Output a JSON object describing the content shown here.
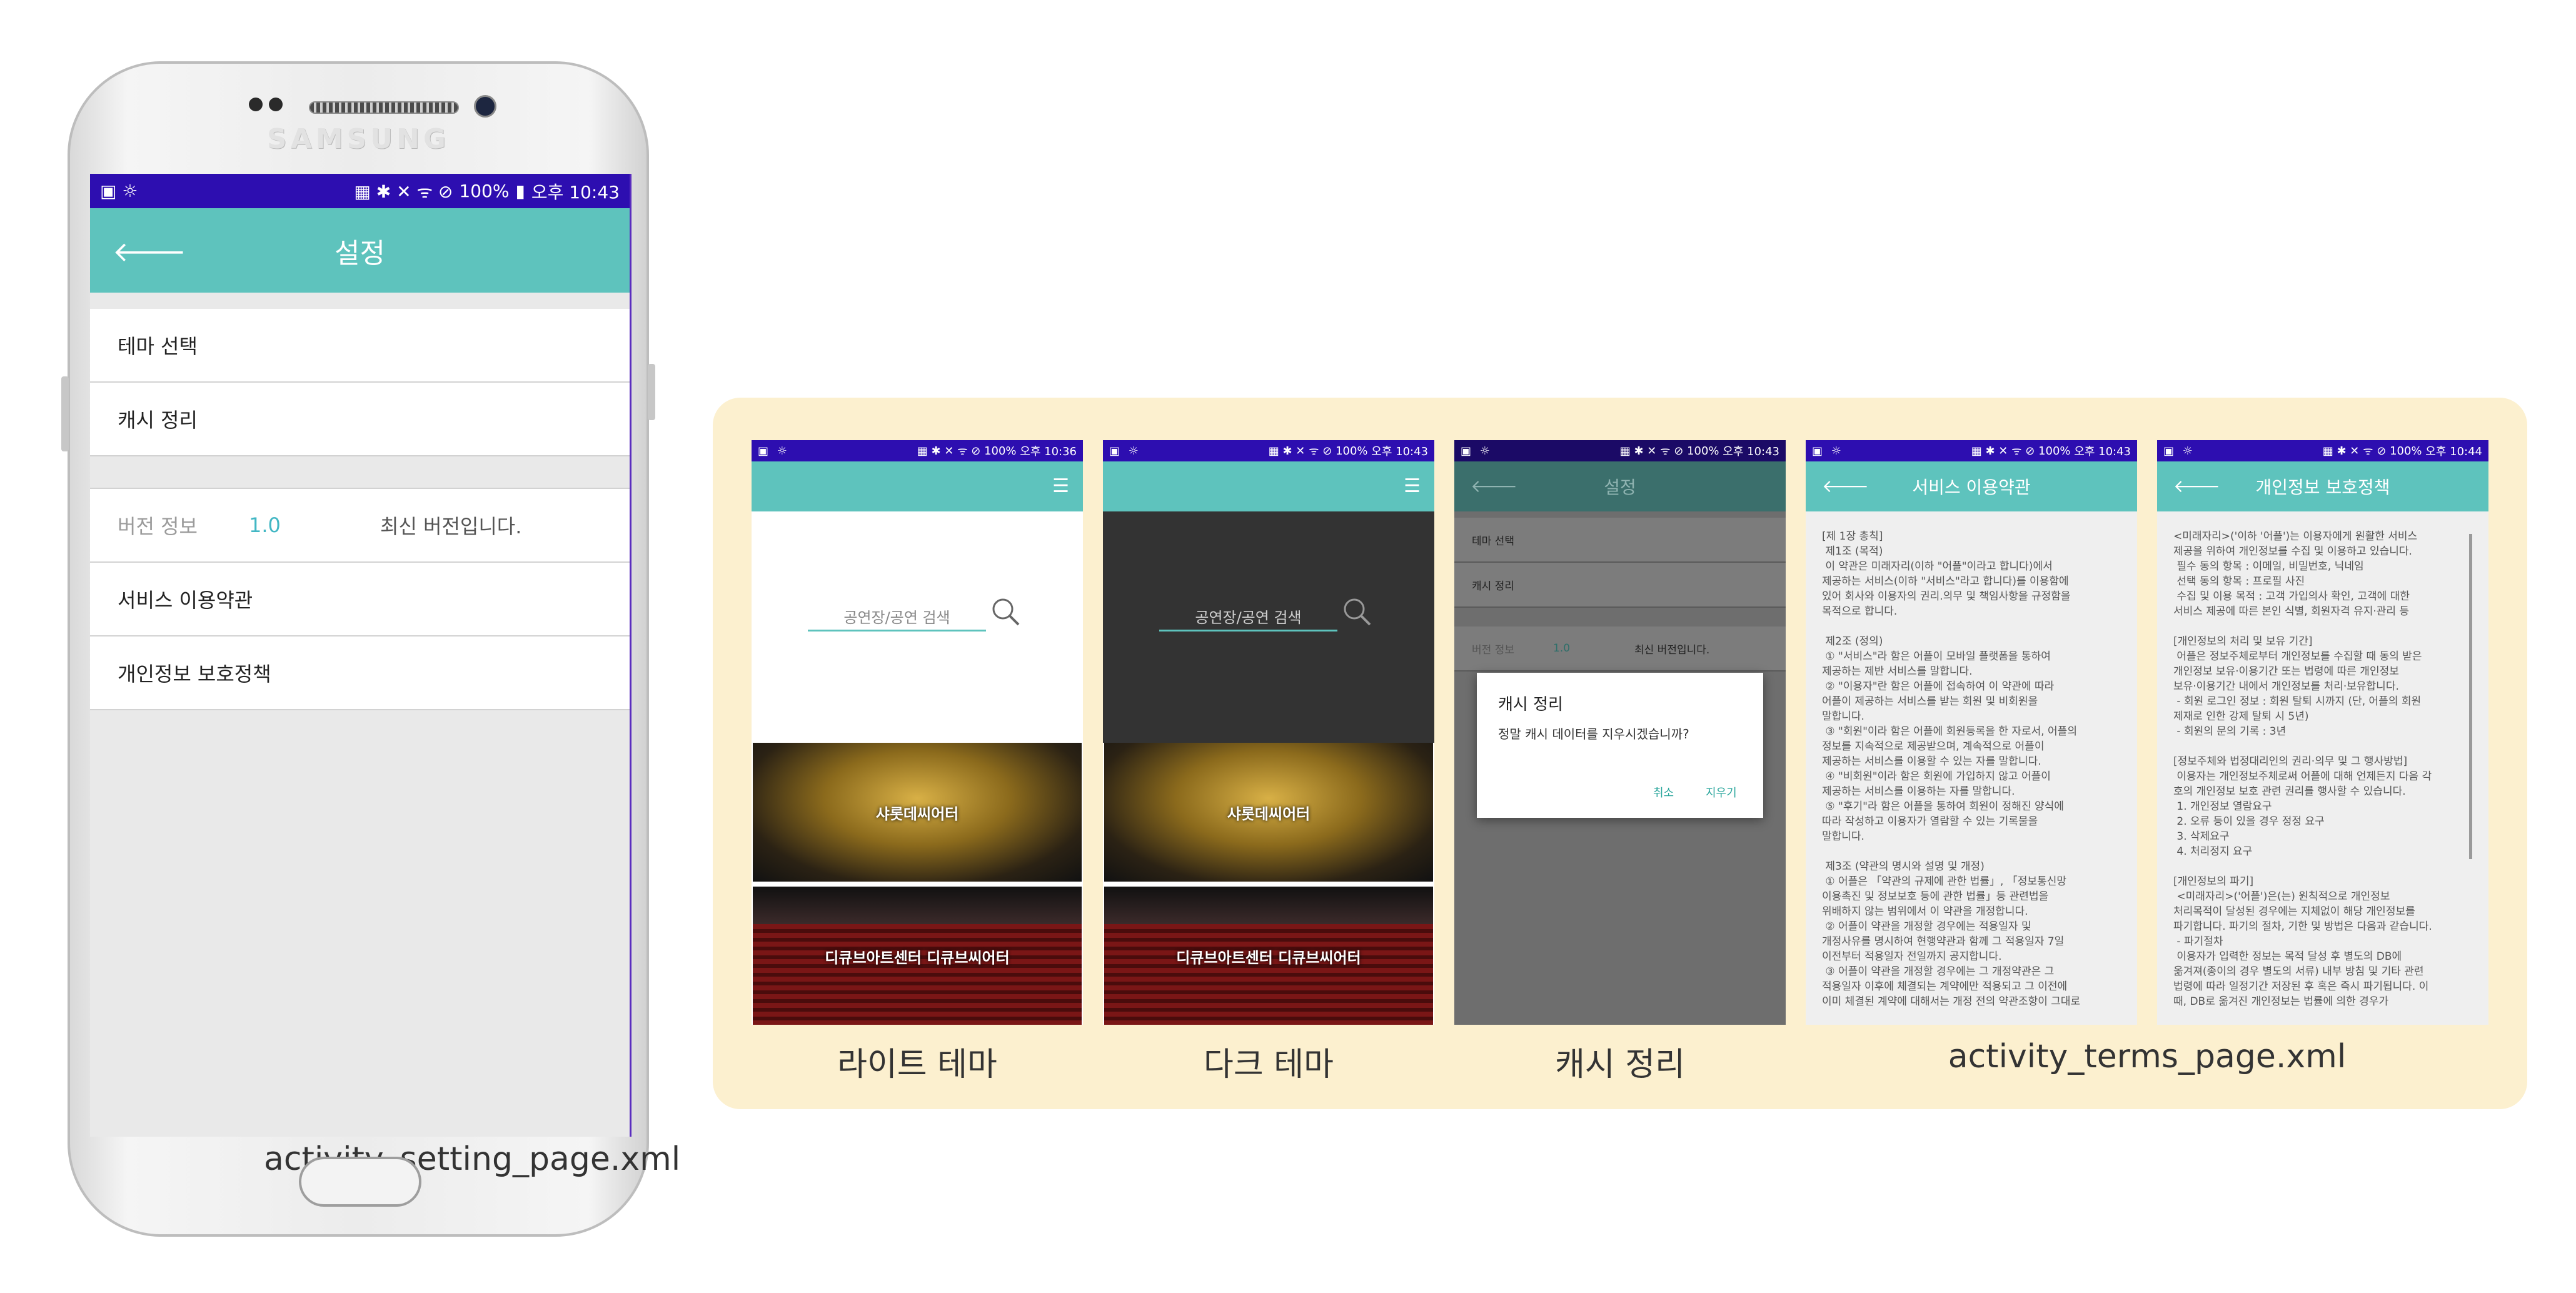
{
  "phone": {
    "brand": "SAMSUNG",
    "status": {
      "left_icons": "▣ ☼",
      "right_icons": "▦ ✱ ✕ ᯤ ⊘",
      "battery": "100%",
      "time": "오후 10:43"
    },
    "appbar": {
      "title": "설정"
    },
    "rows": {
      "theme": "테마 선택",
      "cache": "캐시 정리",
      "version_label": "버전 정보",
      "version_number": "1.0",
      "version_message": "최신 버전입니다.",
      "terms": "서비스 이용약관",
      "privacy": "개인정보 보호정책"
    },
    "caption": "activity_setting_page.xml"
  },
  "screens": {
    "light": {
      "status": {
        "left_icons": "▣ ☼",
        "right_icons": "▦ ✱ ✕ ᯤ ⊘",
        "battery": "100%",
        "time": "오후 10:36"
      },
      "search_placeholder": "공연장/공연 검색",
      "venue1": "샤롯데씨어터",
      "venue2": "디큐브아트센터 디큐브씨어터",
      "caption": "라이트 테마"
    },
    "dark": {
      "status": {
        "left_icons": "▣ ☼",
        "right_icons": "▦ ✱ ✕ ᯤ ⊘",
        "battery": "100%",
        "time": "오후 10:43"
      },
      "search_placeholder": "공연장/공연 검색",
      "venue1": "샤롯데씨어터",
      "venue2": "디큐브아트센터 디큐브씨어터",
      "caption": "다크 테마"
    },
    "cache": {
      "status": {
        "left_icons": "▣ ☼",
        "right_icons": "▦ ✱ ✕ ᯤ ⊘",
        "battery": "100%",
        "time": "오후 10:43"
      },
      "title": "설정",
      "rows": [
        "테마 선택",
        "캐시 정리"
      ],
      "version_label": "버전 정보",
      "version_number": "1.0",
      "version_message": "최신 버전입니다.",
      "dialog_title": "캐시 정리",
      "dialog_message": "정말 캐시 데이터를 지우시겠습니까?",
      "cancel": "취소",
      "confirm": "지우기",
      "caption": "캐시 정리"
    },
    "terms": {
      "status": {
        "left_icons": "▣ ☼",
        "right_icons": "▦ ✱ ✕ ᯤ ⊘",
        "battery": "100%",
        "time": "오후 10:43"
      },
      "title": "서비스 이용약관",
      "body": "[제 1장 총칙]\n 제1조 (목적)\n 이 약관은 미래자리(이하 \"어플\"이라고 합니다)에서\n제공하는 서비스(이하 \"서비스\"라고 합니다)를 이용함에\n있어 회사와 이용자의 권리.의무 및 책임사항을 규정함을\n목적으로 합니다.\n\n 제2조 (정의)\n ① \"서비스\"라 함은 어플이 모바일 플랫폼을 통하여\n제공하는 제반 서비스를 말합니다.\n ② \"이용자\"란 함은 어플에 접속하여 이 약관에 따라\n어플이 제공하는 서비스를 받는 회원 및 비회원을\n말합니다.\n ③ \"회원\"이라 함은 어플에 회원등록을 한 자로서, 어플의\n정보를 지속적으로 제공받으며, 계속적으로 어플이\n제공하는 서비스를 이용할 수 있는 자를 말합니다.\n ④ \"비회원\"이라 함은 회원에 가입하지 않고 어플이\n제공하는 서비스를 이용하는 자를 말합니다.\n ⑤ \"후기\"라 함은 어플을 통하여 회원이 정해진 양식에\n따라 작성하고 이용자가 열람할 수 있는 기록물을\n말합니다.\n\n 제3조 (약관의 명시와 설명 및 개정)\n ① 어플은 「약관의 규제에 관한 법률」, 「정보통신망\n이용촉진 및 정보보호 등에 관한 법률」등 관련법을\n위배하지 않는 범위에서 이 약관을 개정합니다.\n ② 어플이 약관을 개정할 경우에는 적용일자 및\n개정사유를 명시하여 현행약관과 함께 그 적용일자 7일\n이전부터 적용일자 전일까지 공지합니다.\n ③ 어플이 약관을 개정할 경우에는 그 개정약관은 그\n적용일자 이후에 체결되는 계약에만 적용되고 그 이전에\n이미 체결된 계약에 대해서는 개정 전의 약관조항이 그대로"
    },
    "privacy": {
      "status": {
        "left_icons": "▣ ☼",
        "right_icons": "▦ ✱ ✕ ᯤ ⊘",
        "battery": "100%",
        "time": "오후 10:44"
      },
      "title": "개인정보 보호정책",
      "body": "<미래자리>('이하 '어플')는 이용자에게 원활한 서비스\n제공을 위하여 개인정보를 수집 및 이용하고 있습니다.\n 필수 동의 항목 : 이메일, 비밀번호, 닉네임\n 선택 동의 항목 : 프로필 사진\n 수집 및 이용 목적 : 고객 가입의사 확인, 고객에 대한\n서비스 제공에 따른 본인 식별, 회원자격 유지·관리 등\n\n[개인정보의 처리 및 보유 기간]\n 어플은 정보주체로부터 개인정보를 수집할 때 동의 받은\n개인정보 보유·이용기간 또는 법령에 따른 개인정보\n보유·이용기간 내에서 개인정보를 처리·보유합니다.\n - 회원 로그인 정보 : 회원 탈퇴 시까지 (단, 어플의 회원\n제재로 인한 강제 탈퇴 시 5년)\n - 회원의 문의 기록 : 3년\n\n[정보주체와 법정대리인의 권리·의무 및 그 행사방법]\n 이용자는 개인정보주체로써 어플에 대해 언제든지 다음 각\n호의 개인정보 보호 관련 권리를 행사할 수 있습니다.\n 1. 개인정보 열람요구\n 2. 오류 등이 있을 경우 정정 요구\n 3. 삭제요구\n 4. 처리정지 요구\n\n[개인정보의 파기]\n <미래자리>('어플')은(는) 원칙적으로 개인정보\n처리목적이 달성된 경우에는 지체없이 해당 개인정보를\n파기합니다. 파기의 절차, 기한 및 방법은 다음과 같습니다.\n - 파기절차\n 이용자가 입력한 정보는 목적 달성 후 별도의 DB에\n옮겨져(종이의 경우 별도의 서류) 내부 방침 및 기타 관련\n법령에 따라 일정기간 저장된 후 혹은 즉시 파기됩니다. 이\n때, DB로 옮겨진 개인정보는 법률에 의한 경우가"
    },
    "terms_caption": "activity_terms_page.xml"
  },
  "colors": {
    "status_bar": "#2d0eb0",
    "app_bar": "#5ec3bd",
    "accent": "#42b7c4",
    "panel_bg": "#fcf0cf"
  }
}
